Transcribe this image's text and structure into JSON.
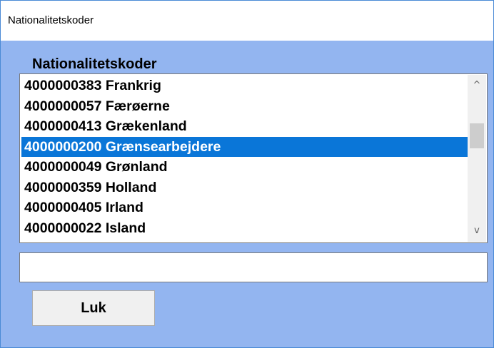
{
  "window": {
    "title": "Nationalitetskoder"
  },
  "group": {
    "label": "Nationalitetskoder"
  },
  "list": {
    "items": [
      "4000000383 Frankrig",
      "4000000057 Færøerne",
      "4000000413 Grækenland",
      "4000000200 Grænsearbejdere",
      "4000000049 Grønland",
      "4000000359 Holland",
      "4000000405 Irland",
      "4000000022 Island"
    ],
    "selected_index": 3
  },
  "scrollbar": {
    "up_icon": "chevron-up-icon",
    "down_icon": "chevron-down-icon",
    "up_glyph": "^",
    "down_glyph": "v"
  },
  "input": {
    "value": ""
  },
  "buttons": {
    "close_label": "Luk"
  },
  "colors": {
    "client_background": "#93b5f0",
    "selection": "#0a76d8",
    "window_border": "#4a8ad6"
  }
}
